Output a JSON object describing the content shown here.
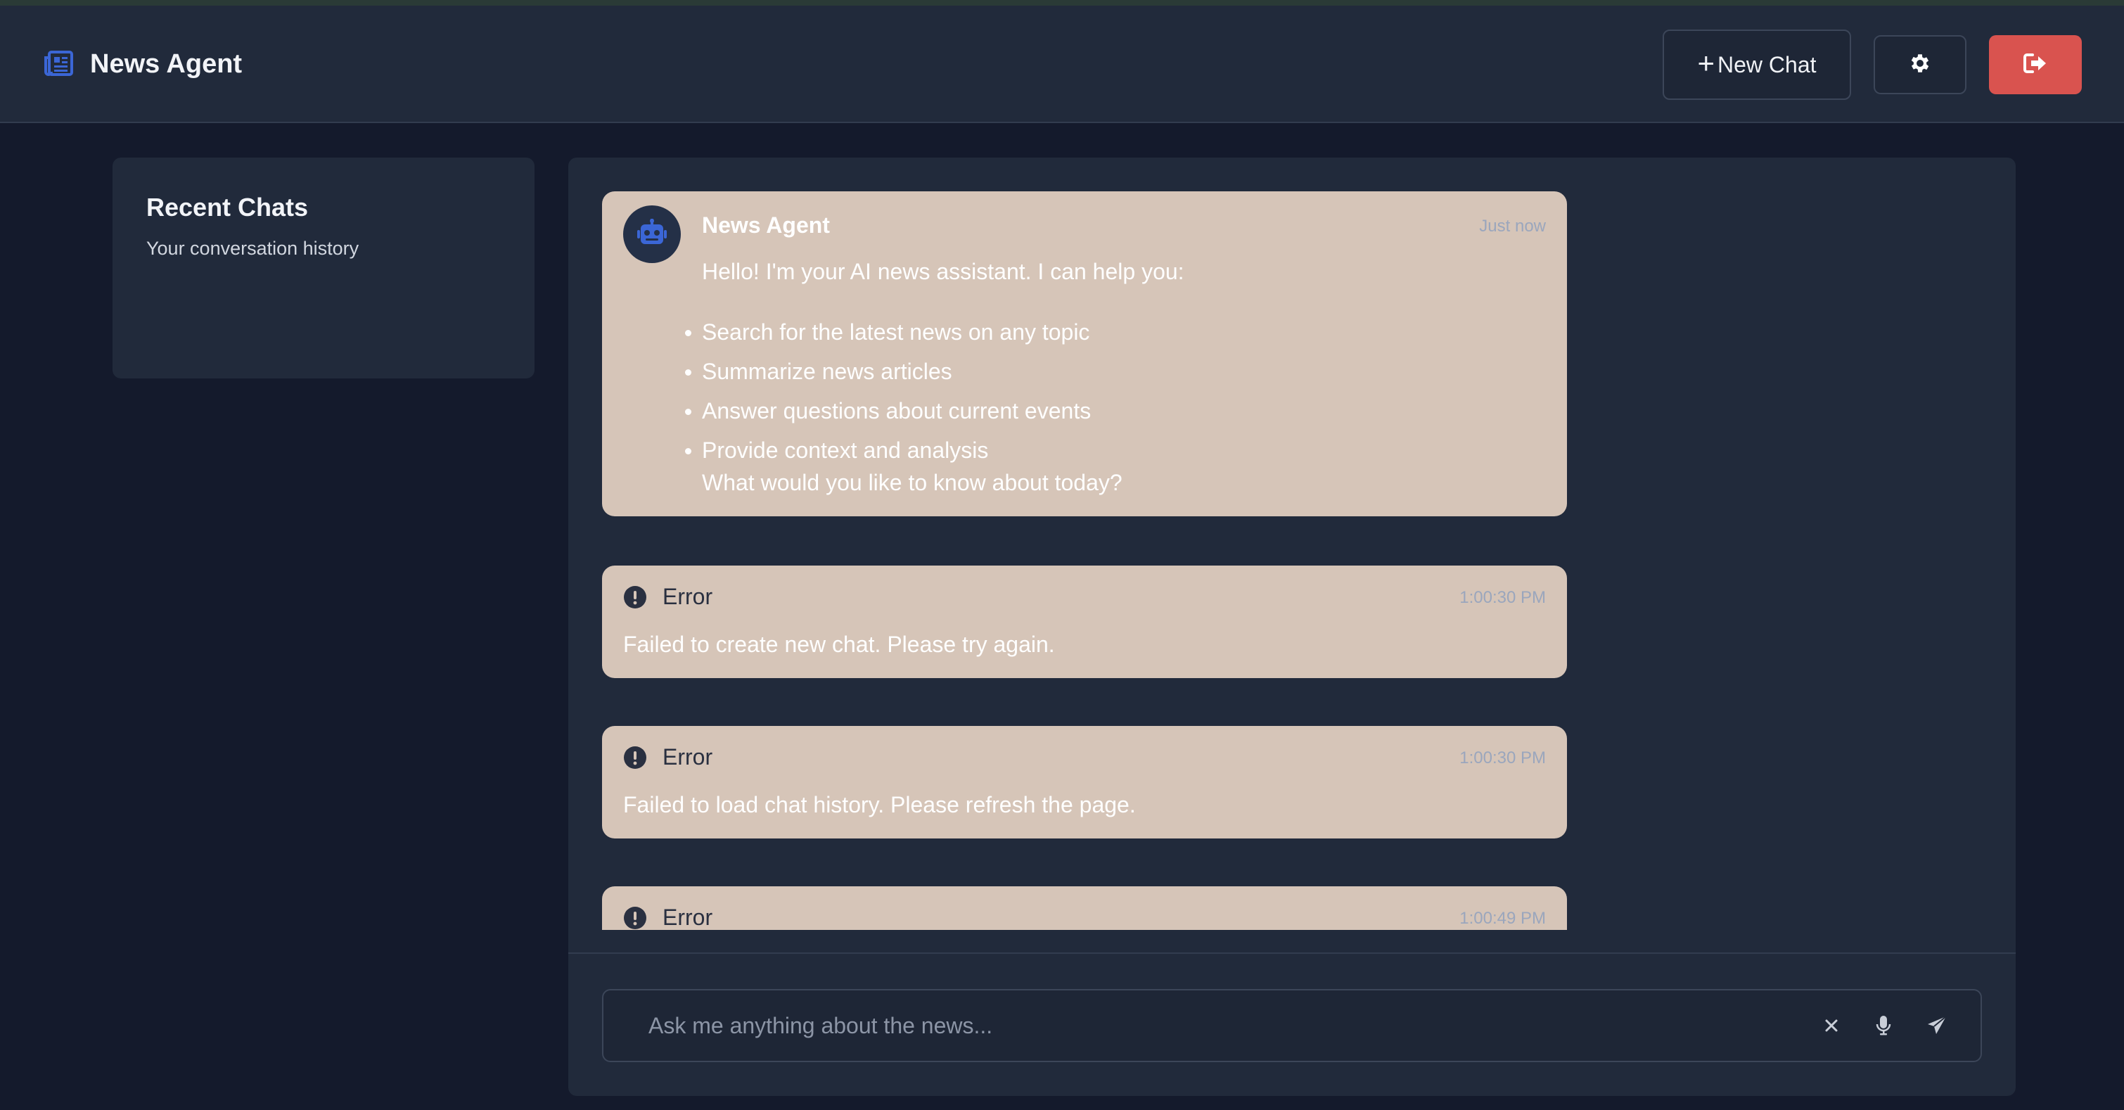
{
  "header": {
    "title": "News Agent",
    "logo_icon": "newspaper-icon",
    "new_chat_label": "New Chat",
    "settings_icon": "gear-icon",
    "logout_icon": "logout-icon"
  },
  "sidebar": {
    "title": "Recent Chats",
    "subtitle": "Your conversation history"
  },
  "messages": [
    {
      "type": "agent",
      "sender": "News Agent",
      "timestamp": "Just now",
      "intro": "Hello! I'm your AI news assistant. I can help you:",
      "items": [
        "Search for the latest news on any topic",
        "Summarize news articles",
        "Answer questions about current events",
        "Provide context and analysis"
      ],
      "outro": "What would you like to know about today?"
    },
    {
      "type": "error",
      "title": "Error",
      "timestamp": "1:00:30 PM",
      "text": "Failed to create new chat. Please try again."
    },
    {
      "type": "error",
      "title": "Error",
      "timestamp": "1:00:30 PM",
      "text": "Failed to load chat history. Please refresh the page."
    },
    {
      "type": "error",
      "title": "Error",
      "timestamp": "1:00:49 PM",
      "text": ""
    }
  ],
  "composer": {
    "placeholder": "Ask me anything about the news...",
    "value": ""
  },
  "colors": {
    "background": "#141a2c",
    "panel": "#212a3b",
    "message_bubble": "#d6c5b8",
    "logout_button": "#d9534f",
    "accent": "#3b66d6"
  }
}
